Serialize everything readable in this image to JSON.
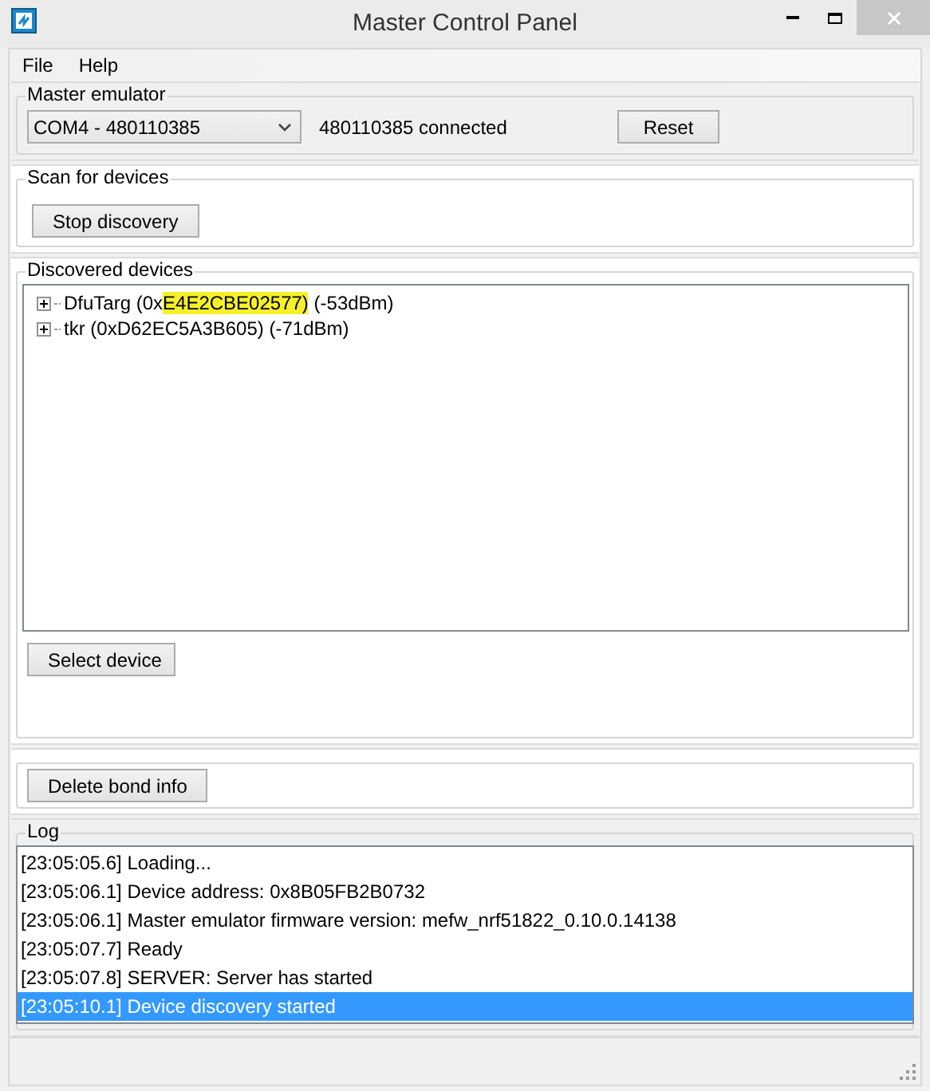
{
  "window": {
    "title": "Master Control Panel"
  },
  "menu": [
    "File",
    "Help"
  ],
  "master_emulator": {
    "title": "Master emulator",
    "port": "COM4 - 480110385",
    "status": "480110385 connected",
    "reset_button": "Reset"
  },
  "scan": {
    "title": "Scan for devices",
    "button": "Stop discovery"
  },
  "discovered": {
    "title": "Discovered devices",
    "devices": [
      {
        "expanded": false,
        "parts": [
          {
            "text": "DfuTarg (0x",
            "highlighted": false
          },
          {
            "text": "E4E2CBE02577)",
            "highlighted": true
          },
          {
            "text": " (-53dBm)",
            "highlighted": false
          }
        ]
      },
      {
        "expanded": false,
        "parts": [
          {
            "text": "tkr (0xD62EC5A3B605) (-71dBm)",
            "highlighted": false
          }
        ]
      }
    ],
    "button": "Select device"
  },
  "bond": {
    "button": "Delete bond info"
  },
  "log": {
    "title": "Log",
    "entries": [
      {
        "text": "[23:05:05.6] Loading...",
        "selected": false
      },
      {
        "text": "[23:05:06.1] Device address: 0x8B05FB2B0732",
        "selected": false
      },
      {
        "text": "[23:05:06.1] Master emulator firmware version: mefw_nrf51822_0.10.0.14138",
        "selected": false
      },
      {
        "text": "[23:05:07.7] Ready",
        "selected": false
      },
      {
        "text": "[23:05:07.8] SERVER: Server has started",
        "selected": false
      },
      {
        "text": "[23:05:10.1] Device discovery started",
        "selected": true
      }
    ]
  }
}
